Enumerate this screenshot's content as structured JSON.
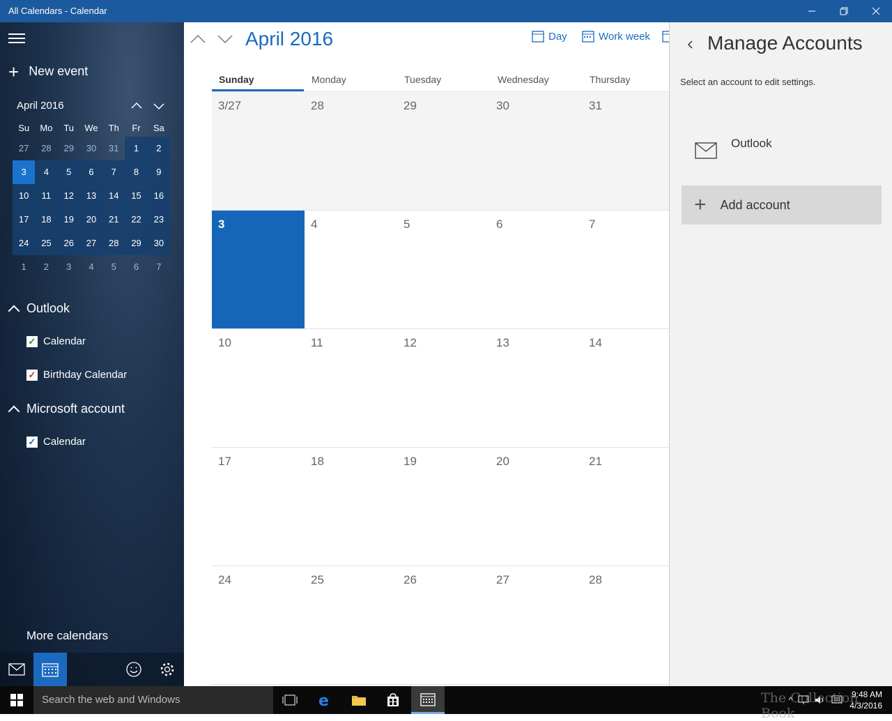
{
  "window": {
    "title": "All Calendars - Calendar"
  },
  "sidebar": {
    "new_event": "New event",
    "mini_calendar": {
      "month": "April 2016",
      "dow": [
        "Su",
        "Mo",
        "Tu",
        "We",
        "Th",
        "Fr",
        "Sa"
      ],
      "weeks": [
        [
          "27",
          "28",
          "29",
          "30",
          "31",
          "1",
          "2"
        ],
        [
          "3",
          "4",
          "5",
          "6",
          "7",
          "8",
          "9"
        ],
        [
          "10",
          "11",
          "12",
          "13",
          "14",
          "15",
          "16"
        ],
        [
          "17",
          "18",
          "19",
          "20",
          "21",
          "22",
          "23"
        ],
        [
          "24",
          "25",
          "26",
          "27",
          "28",
          "29",
          "30"
        ],
        [
          "1",
          "2",
          "3",
          "4",
          "5",
          "6",
          "7"
        ]
      ],
      "today": "3"
    },
    "groups": [
      {
        "name": "Outlook",
        "calendars": [
          {
            "label": "Calendar",
            "color": "#2e8b2e",
            "checked": true
          },
          {
            "label": "Birthday Calendar",
            "color": "#c0392b",
            "checked": true
          }
        ]
      },
      {
        "name": "Microsoft account",
        "calendars": [
          {
            "label": "Calendar",
            "color": "#1b6ac0",
            "checked": true
          }
        ]
      }
    ],
    "more_calendars": "More calendars",
    "footer_icons": [
      "mail-icon",
      "calendar-icon",
      "smiley-feedback-icon",
      "gear-icon"
    ]
  },
  "main": {
    "month_title": "April 2016",
    "views": {
      "day": "Day",
      "work_week": "Work week"
    },
    "days_of_week": [
      "Sunday",
      "Monday",
      "Tuesday",
      "Wednesday",
      "Thursday"
    ],
    "selected_dow": "Sunday",
    "weeks": [
      [
        "3/27",
        "28",
        "29",
        "30",
        "31"
      ],
      [
        "3",
        "4",
        "5",
        "6",
        "7"
      ],
      [
        "10",
        "11",
        "12",
        "13",
        "14"
      ],
      [
        "17",
        "18",
        "19",
        "20",
        "21"
      ],
      [
        "24",
        "25",
        "26",
        "27",
        "28"
      ]
    ],
    "accent_color": "#1b6ac0"
  },
  "panel": {
    "title": "Manage Accounts",
    "subtitle": "Select an account to edit settings.",
    "account_name": "Outlook",
    "add_account": "Add account"
  },
  "taskbar": {
    "search_placeholder": "Search the web and Windows",
    "time": "9:48 AM",
    "date": "4/3/2016",
    "watermark": "The Collection Book"
  }
}
